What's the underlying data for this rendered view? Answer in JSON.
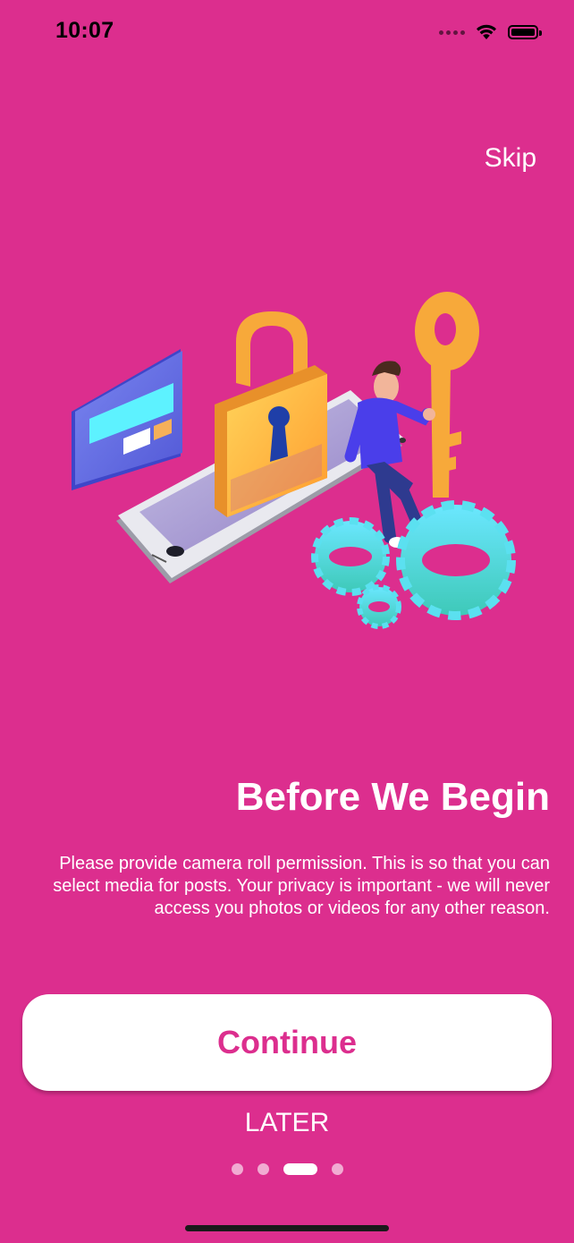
{
  "status_bar": {
    "time": "10:07",
    "icons": [
      "signal-dots-icon",
      "wifi-icon",
      "battery-icon"
    ]
  },
  "header": {
    "skip_label": "Skip"
  },
  "illustration": {
    "icon": "security-illustration"
  },
  "content": {
    "title": "Before We Begin",
    "body": "Please provide camera roll permission. This is so that you can select media for posts. Your privacy is important - we will never access you photos or videos for any other reason."
  },
  "actions": {
    "continue_label": "Continue",
    "later_label": "LATER"
  },
  "pager": {
    "total": 4,
    "active_index": 2
  },
  "colors": {
    "background": "#DC2E8E",
    "accent": "#DC2E8E",
    "button_bg": "#FFFFFF"
  }
}
